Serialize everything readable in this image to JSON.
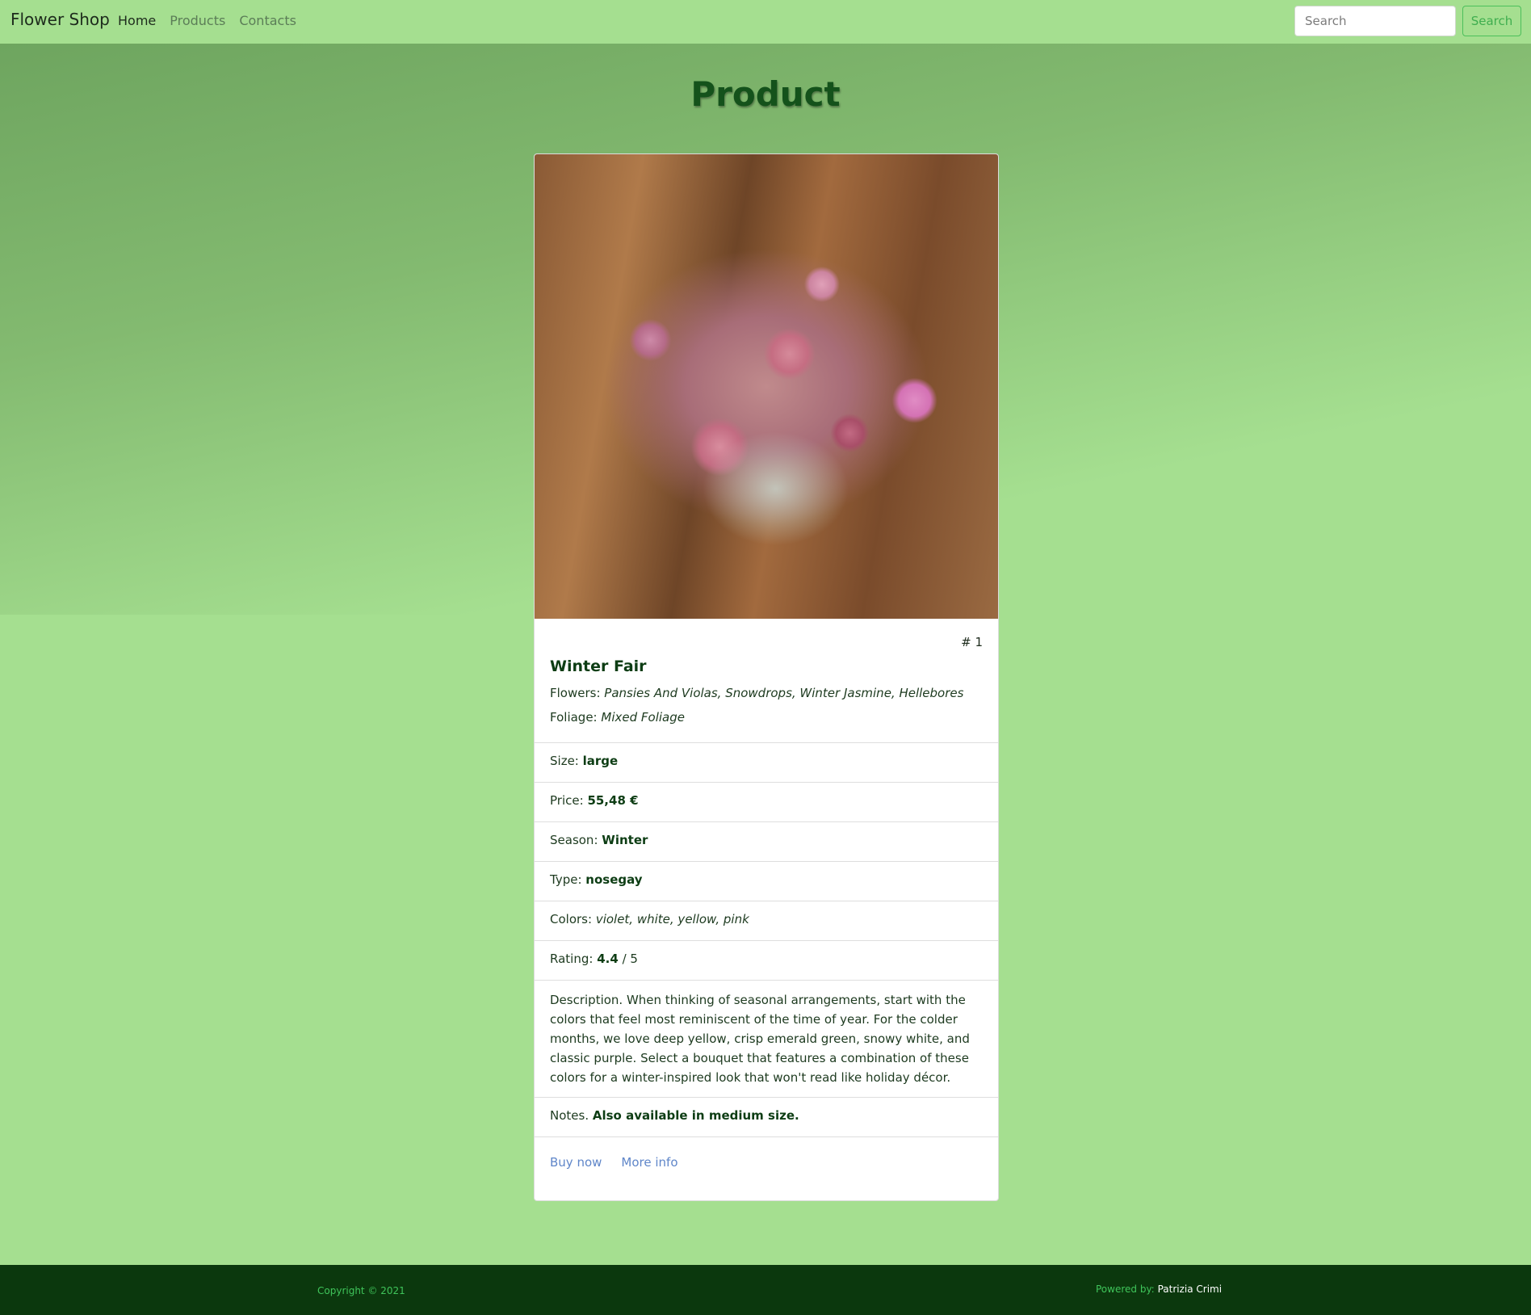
{
  "navbar": {
    "brand": "Flower Shop",
    "links": [
      "Home",
      "Products",
      "Contacts"
    ],
    "search_placeholder": "Search",
    "search_button": "Search"
  },
  "page": {
    "title": "Product"
  },
  "product": {
    "number": "# 1",
    "image_subject": "dried flower bouquet in pink, purple and white on wooden crate",
    "name": "Winter Fair",
    "flowers_label": "Flowers:",
    "flowers_value": "Pansies And Violas, Snowdrops, Winter Jasmine, Hellebores",
    "foliage_label": "Foliage:",
    "foliage_value": "Mixed Foliage",
    "size_label": "Size:",
    "size_value": "large",
    "price_label": "Price:",
    "price_value": "55,48 €",
    "season_label": "Season:",
    "season_value": "Winter",
    "type_label": "Type:",
    "type_value": "nosegay",
    "colors_label": "Colors:",
    "colors_value": "violet, white, yellow, pink",
    "rating_label": "Rating:",
    "rating_value": "4.4",
    "rating_suffix": "/ 5",
    "description": "Description. When thinking of seasonal arrangements, start with the colors that feel most reminiscent of the time of year. For the colder months, we love deep yellow, crisp emerald green, snowy white, and classic purple. Select a bouquet that features a combination of these colors for a winter-inspired look that won't read like holiday décor.",
    "notes_label": "Notes.",
    "notes_value": "Also available in medium size.",
    "buy_now": "Buy now",
    "more_info": "More info"
  },
  "footer": {
    "copyright": "Copyright © 2021",
    "powered_label": "Powered by:",
    "powered_name": "Patrizia Crimi"
  },
  "colors": {
    "navbar_bg": "#a5df90",
    "footer_bg": "#0b380d",
    "title_green": "#14521b",
    "link_blue": "#5f86c9",
    "search_green": "#3fae4f"
  }
}
